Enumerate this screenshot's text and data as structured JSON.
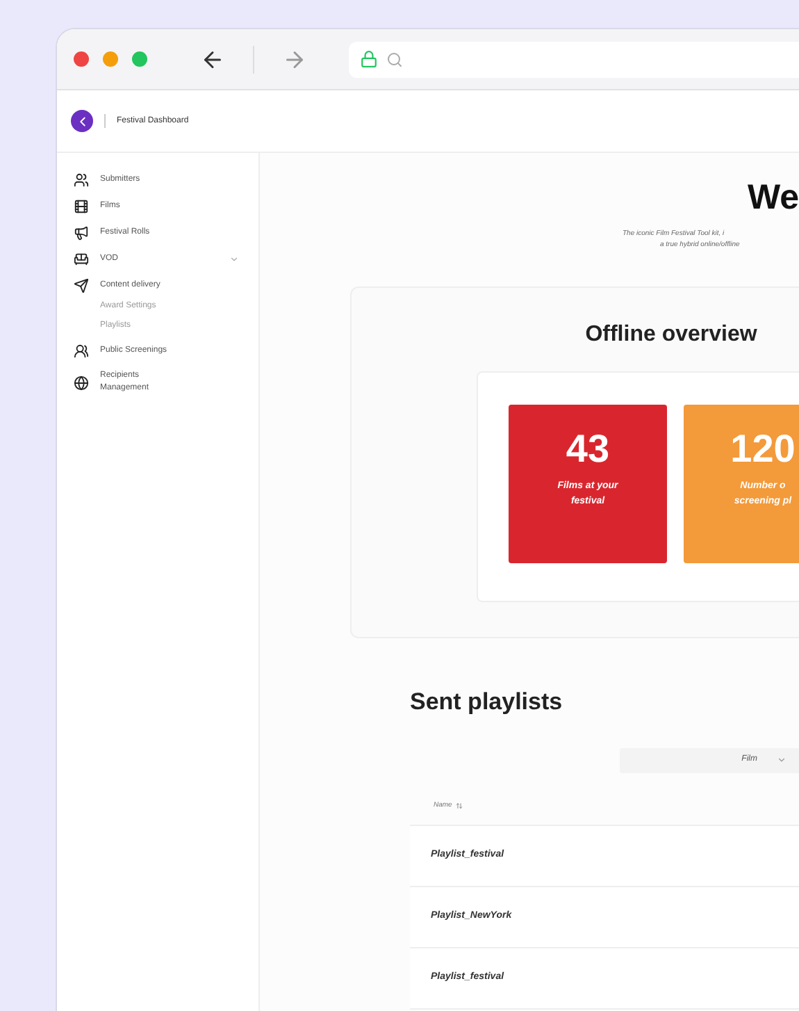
{
  "browser": {
    "address_bar": {
      "secure": true
    }
  },
  "tab": {
    "title": "Festival Dashboard"
  },
  "sidebar": {
    "items": [
      {
        "label": "Submitters"
      },
      {
        "label": "Films"
      },
      {
        "label": "Festival Rolls"
      },
      {
        "label": "VOD",
        "expandable": true
      },
      {
        "label": "Content delivery",
        "children": [
          {
            "label": "Award Settings"
          },
          {
            "label": "Playlists"
          }
        ]
      },
      {
        "label": "Public Screenings"
      },
      {
        "label": "Recipients Management"
      }
    ]
  },
  "welcome": {
    "title": "We",
    "subtitle_lines": [
      "The iconic Film Festival Tool kit, i",
      "a true hybrid online/offline"
    ]
  },
  "overview": {
    "title": "Offline overview",
    "cards": [
      {
        "value": "43",
        "label_lines": [
          "Films at your",
          "festival"
        ],
        "color": "#d9262e"
      },
      {
        "value": "120",
        "label_lines": [
          "Number o",
          "screening pl"
        ],
        "color": "#f39a3a"
      }
    ]
  },
  "playlists": {
    "title": "Sent playlists",
    "filter": {
      "value": "Film"
    },
    "column": "Name",
    "rows": [
      "Playlist_festival",
      "Playlist_NewYork",
      "Playlist_festival"
    ]
  }
}
